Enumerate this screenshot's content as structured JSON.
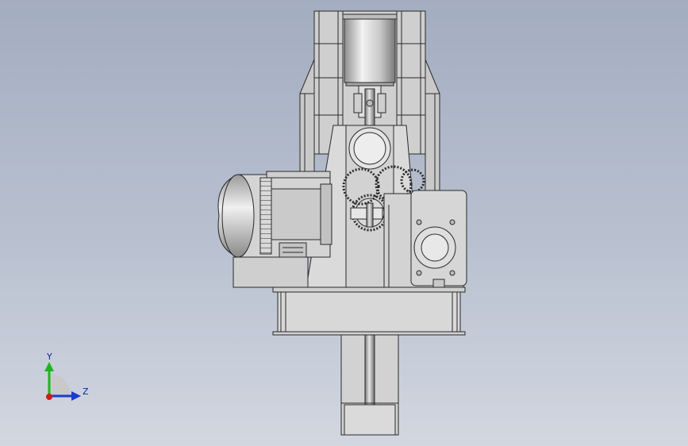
{
  "viewport": {
    "background_top": "#a3adc0",
    "background_bottom": "#d2d7e0"
  },
  "triad": {
    "y_label": "Y",
    "z_label": "Z",
    "y_color": "#1fb51f",
    "z_color": "#1a3ccf",
    "x_color": "#d21a1a"
  },
  "model": {
    "icon": "gear-reducer-assembly-icon",
    "edge_color": "#2a2a2a",
    "face_color": "#d6d6d6"
  }
}
